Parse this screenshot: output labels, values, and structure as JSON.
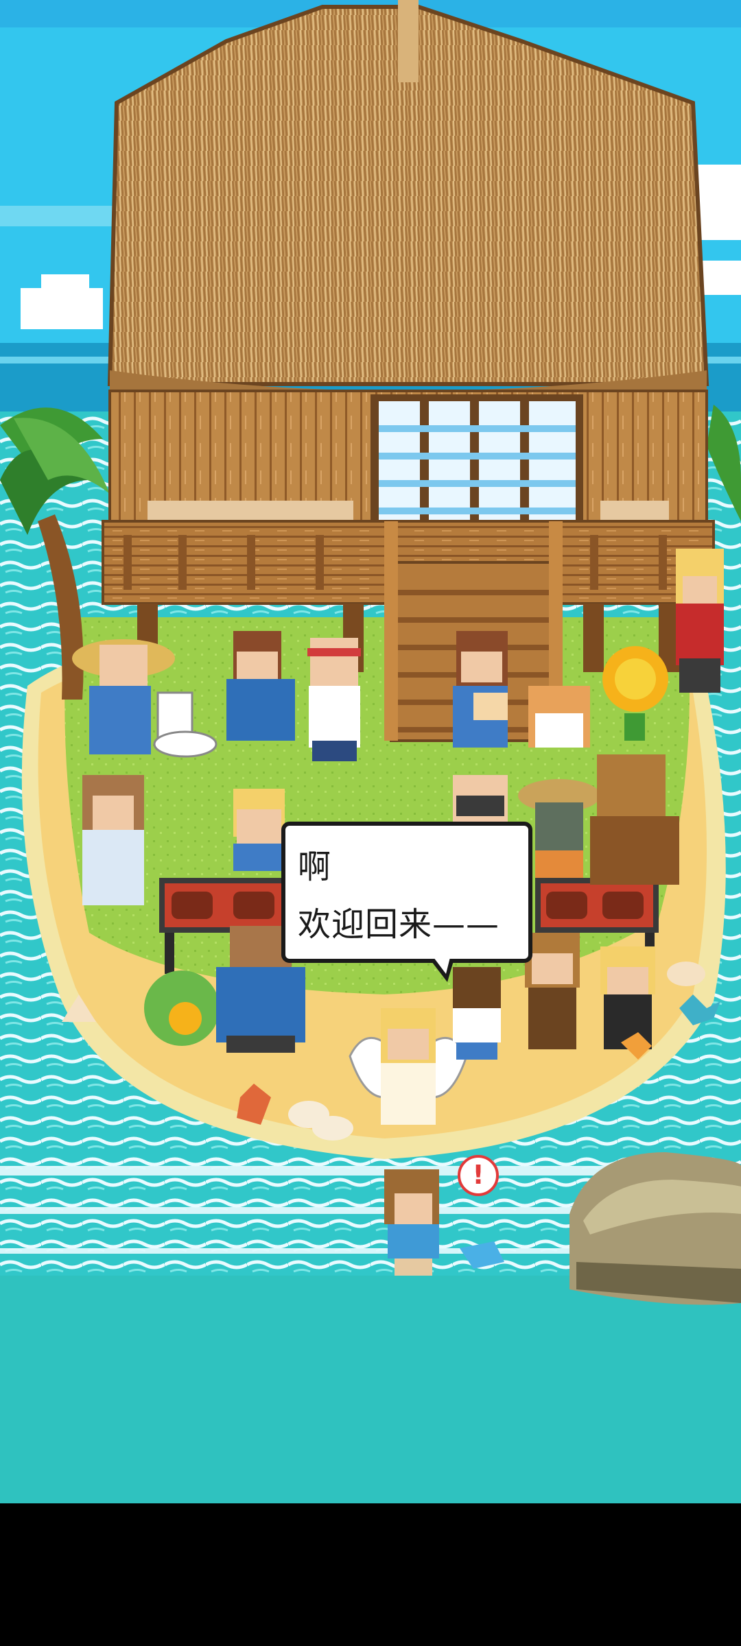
{
  "dialog": {
    "line1": "啊",
    "line2": "欢迎回来——"
  },
  "colors": {
    "sky": "#33c6ee",
    "sea": "#2fc2c4",
    "sand": "#f6d27a",
    "grass": "#9bcf4a",
    "thatch": "#c8a068",
    "wood": "#9c6a34",
    "bubble_border": "#1a1a1a",
    "alert_red": "#e23a3a"
  },
  "icons": {
    "alert": "exclamation-bubble-icon"
  }
}
